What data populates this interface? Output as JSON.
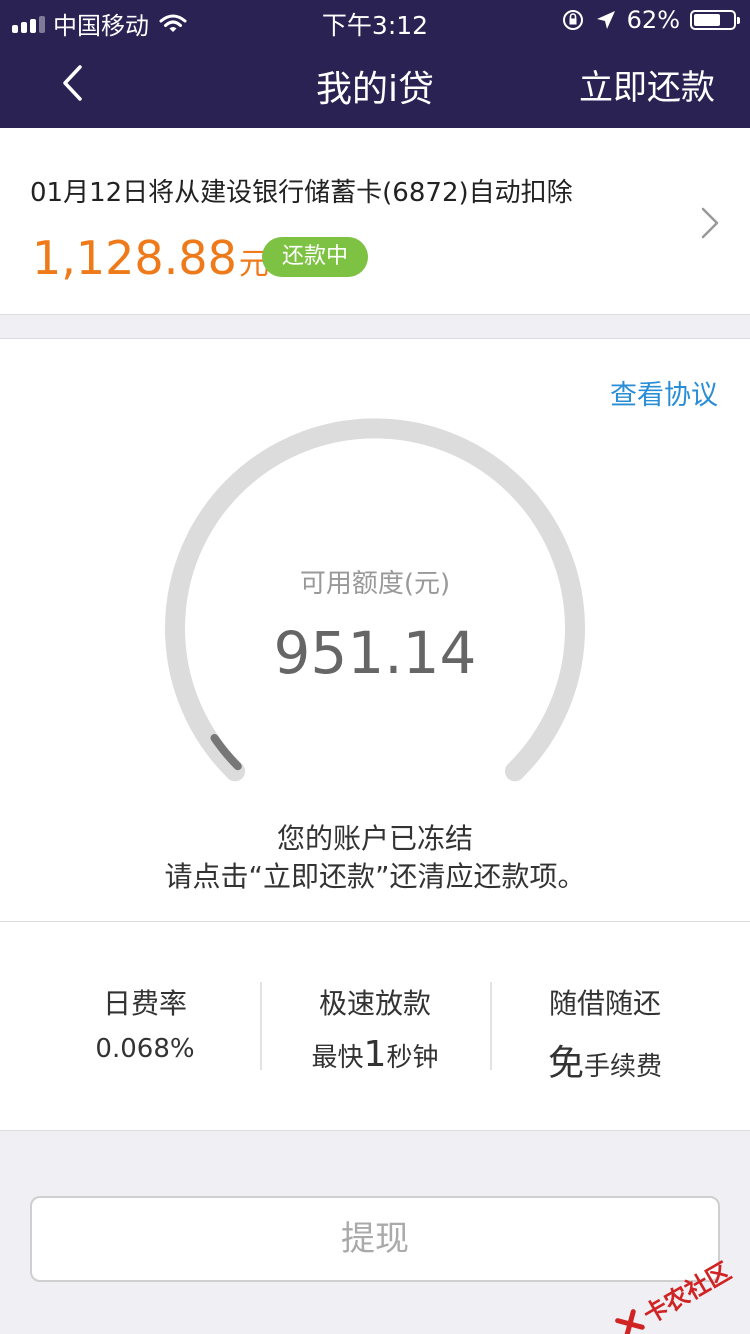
{
  "status_bar": {
    "carrier": "中国移动",
    "time": "下午3:12",
    "battery_text": "62%",
    "battery_level": 0.62,
    "icons": [
      "signal-icon",
      "wifi-icon",
      "rotation-lock-icon",
      "location-arrow-icon",
      "battery-icon"
    ]
  },
  "nav": {
    "back_icon": "chevron-left-icon",
    "title": "我的i贷",
    "right_action": "立即还款"
  },
  "repayment": {
    "description": "01月12日将从建设银行储蓄卡(6872)自动扣除",
    "amount": "1,128.88",
    "unit": "元",
    "status_badge": "还款中",
    "chevron_icon": "chevron-right-icon"
  },
  "credit": {
    "agreement_link": "查看协议",
    "label": "可用额度(元)",
    "available": "951.14",
    "gauge_progress": 0.04,
    "message_line1": "您的账户已冻结",
    "message_line2": "请点击“立即还款”还清应还款项。"
  },
  "features": [
    {
      "title": "日费率",
      "sub_big": "",
      "sub": "0.068%"
    },
    {
      "title": "极速放款",
      "sub_pre": "最快",
      "sub_big": "1",
      "sub": "秒钟"
    },
    {
      "title": "随借随还",
      "sub_big": "免",
      "sub": "手续费"
    }
  ],
  "withdraw_button": "提现",
  "watermark": "卡农社区",
  "colors": {
    "header_bg": "#2b2254",
    "amount": "#ef7a1a",
    "badge_bg": "#7dc242",
    "link": "#2a8ed6"
  }
}
